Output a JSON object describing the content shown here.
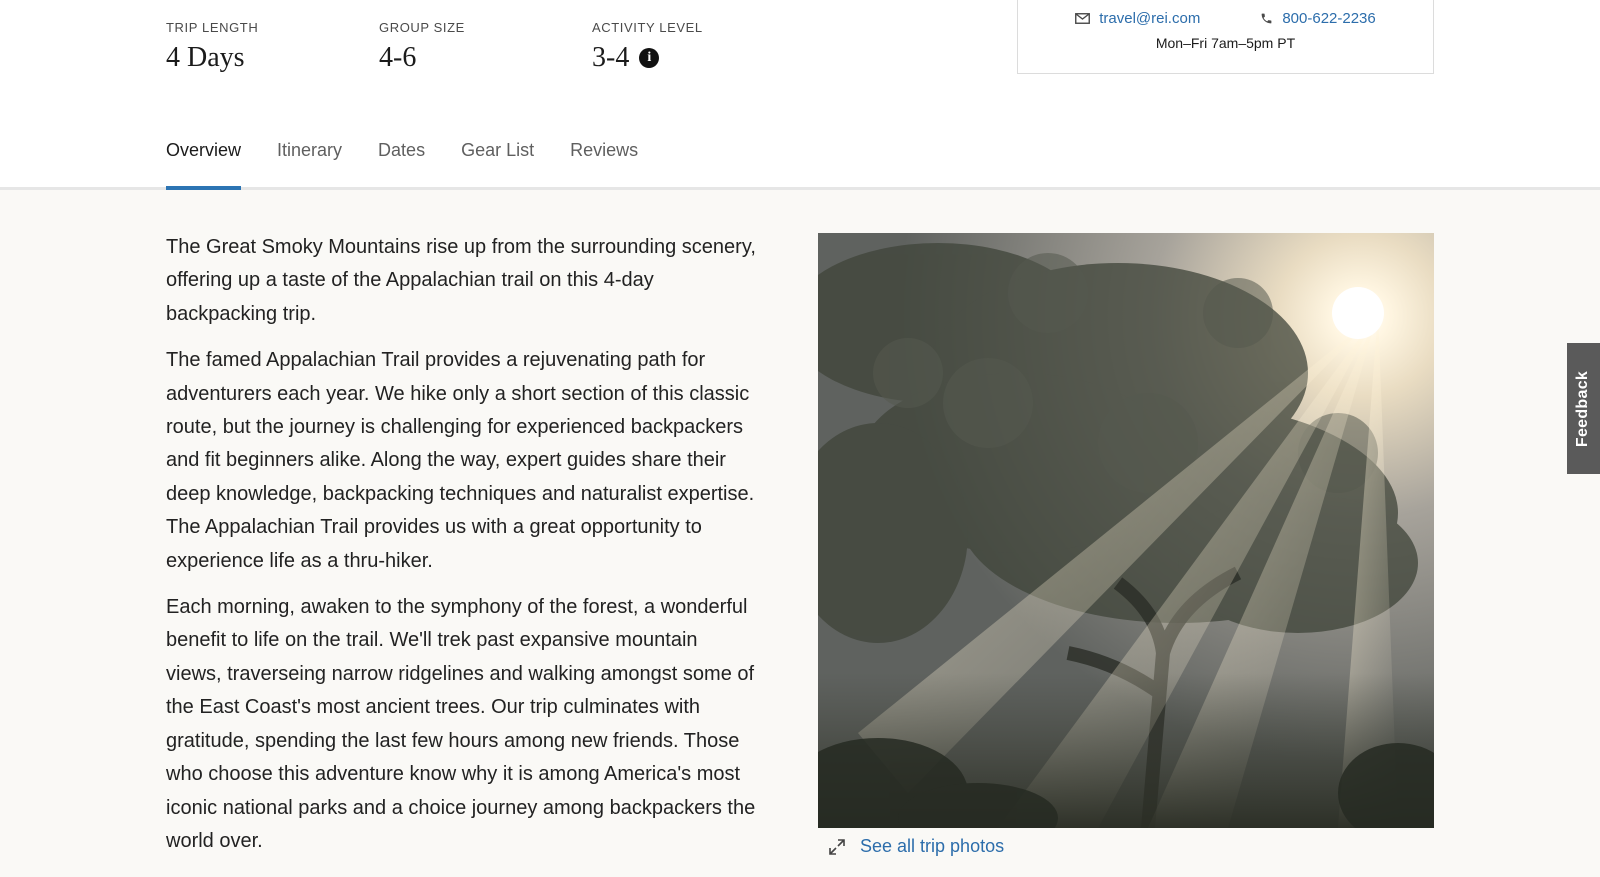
{
  "stats": [
    {
      "label": "TRIP LENGTH",
      "value": "4 Days"
    },
    {
      "label": "GROUP SIZE",
      "value": "4-6"
    },
    {
      "label": "ACTIVITY LEVEL",
      "value": "3-4"
    }
  ],
  "contact": {
    "email": "travel@rei.com",
    "phone": "800-622-2236",
    "hours": "Mon–Fri 7am–5pm PT",
    "email_icon": "mail-icon",
    "phone_icon": "phone-icon"
  },
  "tabs": [
    {
      "label": "Overview",
      "active": true
    },
    {
      "label": "Itinerary",
      "active": false
    },
    {
      "label": "Dates",
      "active": false
    },
    {
      "label": "Gear List",
      "active": false
    },
    {
      "label": "Reviews",
      "active": false
    }
  ],
  "overview": {
    "paragraphs": [
      "The Great Smoky Mountains rise up from the surrounding scenery, offering up a taste of the Appalachian trail on this 4-day backpacking trip.",
      "The famed Appalachian Trail provides a rejuvenating path for adventurers each year. We hike only a short section of this classic route, but the journey is challenging for experienced backpackers and fit beginners alike. Along the way, expert guides share their deep knowledge, backpacking techniques and naturalist expertise. The Appalachian Trail provides us with a great opportunity to experience life as a thru-hiker.",
      "Each morning, awaken to the symphony of the forest, a wonderful benefit to life on the trail. We'll trek past expansive mountain views, traverseing narrow ridgelines and walking amongst some of the East Coast's most ancient trees. Our trip culminates with gratitude, spending the last few hours among new friends. Those who choose this adventure know why it is among America's most iconic national parks and a choice journey among backpackers the world over."
    ]
  },
  "photo": {
    "see_all_label": "See all trip photos",
    "expand_icon": "expand-icon"
  },
  "feedback": {
    "label": "Feedback"
  },
  "colors": {
    "accent": "#2c74b3",
    "link": "#2c6dab",
    "content_bg": "#faf9f6"
  }
}
